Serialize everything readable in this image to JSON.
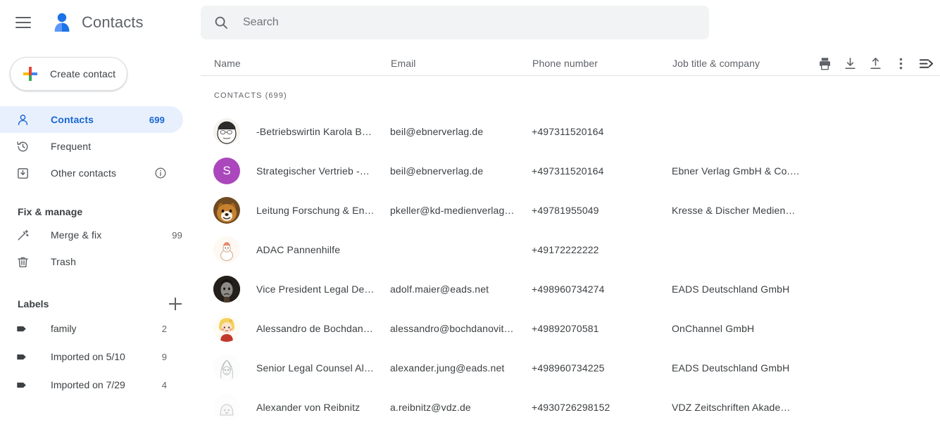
{
  "app": {
    "title": "Contacts",
    "menu_icon": "hamburger-menu-icon",
    "logo_icon": "contacts-person-logo"
  },
  "sidebar": {
    "create_button": {
      "label": "Create contact",
      "icon": "google-plus-icon"
    },
    "nav": [
      {
        "label": "Contacts",
        "count": "699",
        "icon": "person-icon",
        "active": true
      },
      {
        "label": "Frequent",
        "count": "",
        "icon": "history-clock-icon",
        "active": false
      },
      {
        "label": "Other contacts",
        "count": "",
        "icon": "inbox-down-icon",
        "info": "info-icon",
        "active": false
      }
    ],
    "fix_manage": {
      "title": "Fix & manage",
      "items": [
        {
          "label": "Merge & fix",
          "count": "99",
          "icon": "magic-wand-icon"
        },
        {
          "label": "Trash",
          "count": "",
          "icon": "trash-icon"
        }
      ]
    },
    "labels": {
      "title": "Labels",
      "add_icon": "plus-icon",
      "items": [
        {
          "label": "family",
          "count": "2",
          "icon": "label-tag-icon"
        },
        {
          "label": "Imported on 5/10",
          "count": "9",
          "icon": "label-tag-icon"
        },
        {
          "label": "Imported on 7/29",
          "count": "4",
          "icon": "label-tag-icon"
        }
      ]
    }
  },
  "search": {
    "placeholder": "Search",
    "value": "",
    "icon": "search-icon"
  },
  "toolbar": [
    {
      "name": "print-icon",
      "title": "Print"
    },
    {
      "name": "import-download-icon",
      "title": "Import"
    },
    {
      "name": "export-upload-icon",
      "title": "Export"
    },
    {
      "name": "more-options-icon",
      "title": "More options"
    },
    {
      "name": "sort-list-arrow-icon",
      "title": "Change view"
    }
  ],
  "table": {
    "columns": [
      "Name",
      "Email",
      "Phone number",
      "Job title & company"
    ],
    "section_label": "CONTACTS (699)",
    "rows": [
      {
        "name": "-Betriebswirtin Karola B…",
        "email": "beil@ebnerverlag.de",
        "phone": "+497311520164",
        "job": "",
        "avatar": {
          "type": "image",
          "kind": "white-cartoon-face",
          "bg": "#f2efe9",
          "initial": ""
        }
      },
      {
        "name": "Strategischer Vertrieb -…",
        "email": "beil@ebnerverlag.de",
        "phone": "+497311520164",
        "job": "Ebner Verlag GmbH & Co.…",
        "avatar": {
          "type": "initial",
          "kind": "letter-avatar",
          "bg": "#ab47bc",
          "initial": "S"
        }
      },
      {
        "name": "Leitung Forschung & En…",
        "email": "pkeller@kd-medienverlag…",
        "phone": "+49781955049",
        "job": "Kresse & Discher Medien…",
        "avatar": {
          "type": "image",
          "kind": "shiba-dog-photo",
          "bg": "#8a5a2b",
          "initial": ""
        }
      },
      {
        "name": "ADAC Pannenhilfe",
        "email": "",
        "phone": "+49172222222",
        "job": "",
        "avatar": {
          "type": "image",
          "kind": "snowman-illustration",
          "bg": "#fdf8f0",
          "initial": ""
        }
      },
      {
        "name": "Vice President Legal De…",
        "email": "adolf.maier@eads.net",
        "phone": "+498960734274",
        "job": "EADS Deutschland GmbH",
        "avatar": {
          "type": "image",
          "kind": "dark-portrait-photo",
          "bg": "#2b2724",
          "initial": ""
        }
      },
      {
        "name": "Alessandro de Bochdan…",
        "email": "alessandro@bochdanovit…",
        "phone": "+49892070581",
        "job": "OnChannel GmbH",
        "avatar": {
          "type": "image",
          "kind": "blonde-girl-illustration",
          "bg": "#fdfaf2",
          "initial": ""
        }
      },
      {
        "name": "Senior Legal Counsel Al…",
        "email": "alexander.jung@eads.net",
        "phone": "+498960734225",
        "job": "EADS Deutschland GmbH",
        "avatar": {
          "type": "image",
          "kind": "pale-sketch-drawing",
          "bg": "#fbfbfb",
          "initial": ""
        }
      },
      {
        "name": "Alexander von Reibnitz",
        "email": "a.reibnitz@vdz.de",
        "phone": "+4930726298152",
        "job": "VDZ Zeitschriften Akade…",
        "avatar": {
          "type": "image",
          "kind": "pale-blob-illustration",
          "bg": "#fcfcfc",
          "initial": ""
        }
      }
    ]
  },
  "colors": {
    "accent_blue": "#1967d2",
    "active_pill": "#e8f0fe",
    "search_bg": "#f1f3f4",
    "text_primary": "#3c4043",
    "text_secondary": "#5f6368"
  }
}
